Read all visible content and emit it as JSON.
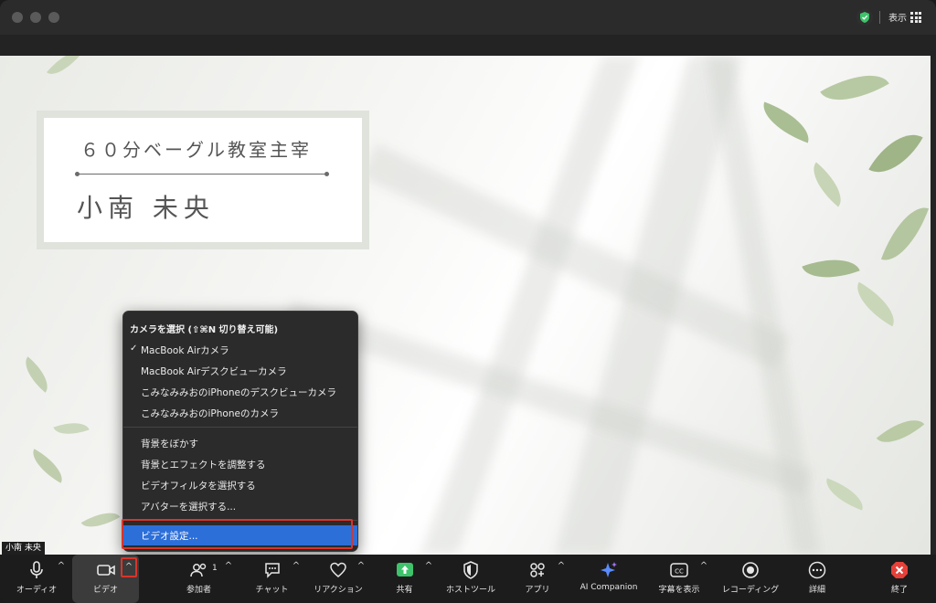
{
  "titlebar": {
    "view_label": "表示"
  },
  "nameplate": {
    "title": "６０分ベーグル教室主宰",
    "name": "小南 未央"
  },
  "camera_menu": {
    "header": "カメラを選択 (⇧⌘N 切り替え可能)",
    "cameras": [
      {
        "label": "MacBook Airカメラ",
        "checked": true
      },
      {
        "label": "MacBook Airデスクビューカメラ",
        "checked": false
      },
      {
        "label": "こみなみみおのiPhoneのデスクビューカメラ",
        "checked": false
      },
      {
        "label": "こみなみみおのiPhoneのカメラ",
        "checked": false
      }
    ],
    "options": [
      "背景をぼかす",
      "背景とエフェクトを調整する",
      "ビデオフィルタを選択する",
      "アバターを選択する..."
    ],
    "settings": "ビデオ設定..."
  },
  "participant_name": "小南 未央",
  "toolbar": {
    "audio": "オーディオ",
    "video": "ビデオ",
    "participants": "参加者",
    "participants_count": "1",
    "chat": "チャット",
    "reactions": "リアクション",
    "share": "共有",
    "host_tools": "ホストツール",
    "apps": "アプリ",
    "ai_companion": "AI Companion",
    "captions": "字幕を表示",
    "recording": "レコーディング",
    "more": "詳細",
    "end": "終了"
  },
  "colors": {
    "accent": "#2d6fd9",
    "highlight": "#d9342b",
    "share": "#3ec36b",
    "end": "#e5413a"
  }
}
